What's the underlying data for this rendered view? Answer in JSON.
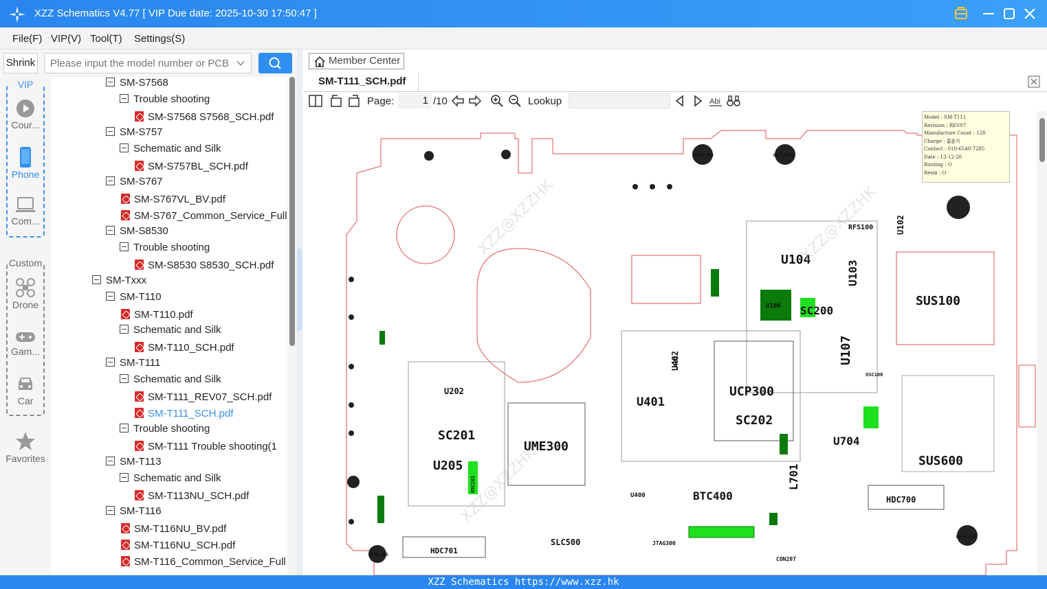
{
  "window": {
    "title": "XZZ Schematics V4.77 [ VIP Due date: 2025-10-30 17:50:47 ]"
  },
  "menu": [
    "File(F)",
    "VIP(V)",
    "Tool(T)",
    "Settings(S)"
  ],
  "search": {
    "shrink_label": "Shrink",
    "placeholder": "Please input the model number or PCB"
  },
  "sidebar": {
    "vip_label": "VIP",
    "custom_label": "Custom",
    "items": [
      {
        "label": "Cour...",
        "icon": "play-icon"
      },
      {
        "label": "Phone",
        "icon": "phone-icon"
      },
      {
        "label": "Com...",
        "icon": "laptop-icon"
      },
      {
        "label": "Drone",
        "icon": "drone-icon"
      },
      {
        "label": "Gam...",
        "icon": "gamepad-icon"
      },
      {
        "label": "Car",
        "icon": "car-icon"
      },
      {
        "label": "Favorites",
        "icon": "star-icon"
      }
    ]
  },
  "tree": [
    {
      "level": 2,
      "kind": "folder",
      "label": "SM-S7568"
    },
    {
      "level": 3,
      "kind": "folder",
      "label": "Trouble shooting"
    },
    {
      "level": 4,
      "kind": "pdf",
      "label": "SM-S7568 S7568_SCH.pdf"
    },
    {
      "level": 2,
      "kind": "folder",
      "label": "SM-S757"
    },
    {
      "level": 3,
      "kind": "folder",
      "label": "Schematic and Silk"
    },
    {
      "level": 4,
      "kind": "pdf",
      "label": "SM-S757BL_SCH.pdf"
    },
    {
      "level": 2,
      "kind": "folder",
      "label": "SM-S767"
    },
    {
      "level": 3,
      "kind": "pdf",
      "label": "SM-S767VL_BV.pdf"
    },
    {
      "level": 3,
      "kind": "pdf",
      "label": "SM-S767_Common_Service_Full"
    },
    {
      "level": 2,
      "kind": "folder",
      "label": "SM-S8530"
    },
    {
      "level": 3,
      "kind": "folder",
      "label": "Trouble shooting"
    },
    {
      "level": 4,
      "kind": "pdf",
      "label": "SM-S8530 S8530_SCH.pdf"
    },
    {
      "level": 1,
      "kind": "folder",
      "label": "SM-Txxx"
    },
    {
      "level": 2,
      "kind": "folder",
      "label": "SM-T110"
    },
    {
      "level": 3,
      "kind": "pdf",
      "label": "SM-T110.pdf"
    },
    {
      "level": 3,
      "kind": "folder",
      "label": "Schematic and Silk"
    },
    {
      "level": 4,
      "kind": "pdf",
      "label": "SM-T110_SCH.pdf"
    },
    {
      "level": 2,
      "kind": "folder",
      "label": "SM-T111"
    },
    {
      "level": 3,
      "kind": "folder",
      "label": "Schematic and Silk"
    },
    {
      "level": 4,
      "kind": "pdf",
      "label": "SM-T111_REV07_SCH.pdf"
    },
    {
      "level": 4,
      "kind": "pdf",
      "label": "SM-T111_SCH.pdf",
      "selected": true
    },
    {
      "level": 3,
      "kind": "folder",
      "label": "Trouble shooting"
    },
    {
      "level": 4,
      "kind": "pdf",
      "label": "SM-T111 Trouble shooting(1"
    },
    {
      "level": 2,
      "kind": "folder",
      "label": "SM-T113"
    },
    {
      "level": 3,
      "kind": "folder",
      "label": "Schematic and Silk"
    },
    {
      "level": 4,
      "kind": "pdf",
      "label": "SM-T113NU_SCH.pdf"
    },
    {
      "level": 2,
      "kind": "folder",
      "label": "SM-T116"
    },
    {
      "level": 3,
      "kind": "pdf",
      "label": "SM-T116NU_BV.pdf"
    },
    {
      "level": 3,
      "kind": "pdf",
      "label": "SM-T116NU_SCH.pdf"
    },
    {
      "level": 3,
      "kind": "pdf",
      "label": "SM-T116_Common_Service_Full"
    }
  ],
  "viewer": {
    "member_center": "Member Center",
    "tab_title": "SM-T111_SCH.pdf",
    "page_label": "Page:",
    "page_current": "1",
    "page_total": "/10",
    "lookup_label": "Lookup",
    "lookup_value": ""
  },
  "pcb": {
    "info": [
      "Model : SM-T111",
      "Revision : REV07",
      "Manufacture Count : 120",
      "Charge : 홍윤기",
      "Contact : 010-6540-7285",
      "Date : 13-12-20",
      "Routing : O",
      "Resin : O"
    ],
    "components": [
      "U104",
      "U103",
      "U102",
      "RFS100",
      "SUS100",
      "U107",
      "UCP300",
      "SC202",
      "U401",
      "U402",
      "U704",
      "SC201",
      "U202",
      "U205",
      "UME300",
      "SUS600",
      "L701",
      "BTC400",
      "HDC700",
      "HDC701",
      "SLC500",
      "JTAG300",
      "CON207",
      "SC200",
      "U106",
      "L402",
      "U400",
      "OSC201",
      "OSC100",
      "BOTH_400",
      "BOTH_401",
      "BOTH_402",
      "BOTH_405"
    ],
    "watermark": "XZZ@XZZHK"
  },
  "status": {
    "text": "XZZ Schematics https://www.xzz.hk"
  },
  "colors": {
    "titlebar": "#2a86ee",
    "accent": "#2f8ff0",
    "board_outline": "#e05050",
    "selected_file": "#3a8ee6",
    "component_green": "#0a7a0a"
  }
}
